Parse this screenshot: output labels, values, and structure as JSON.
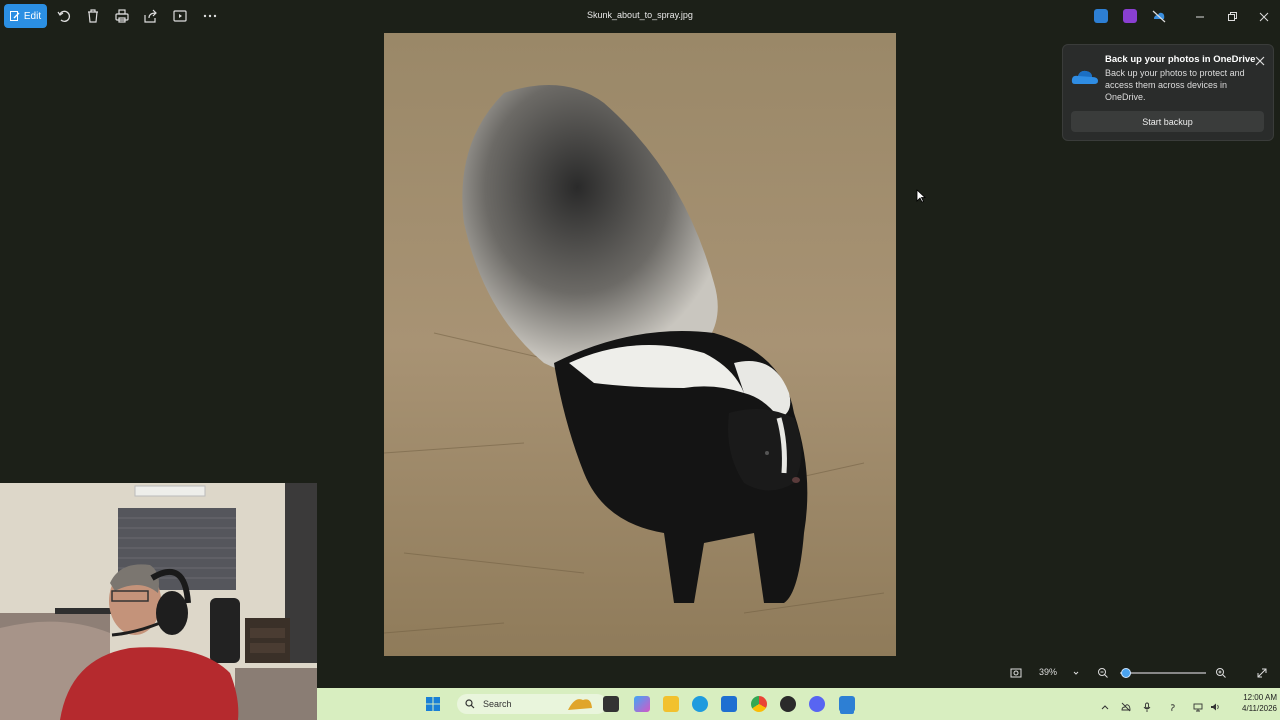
{
  "toolbar": {
    "edit_label": "Edit",
    "icons": [
      "rotate-icon",
      "delete-icon",
      "print-icon",
      "share-icon",
      "slideshow-icon",
      "more-icon"
    ]
  },
  "window": {
    "file_title": "Skunk_about_to_spray.jpg"
  },
  "notification": {
    "title": "Back up your photos in OneDrive",
    "body": "Back up your photos to protect and access them across devices in OneDrive.",
    "button": "Start backup"
  },
  "zoom": {
    "value": "39%",
    "slider_level": 0.06
  },
  "taskbar": {
    "search_placeholder": "Search",
    "time": "12:00 AM",
    "date": "4/11/2026"
  },
  "colors": {
    "accent": "#2b8fe3",
    "background": "#1c2018",
    "taskbar": "#d8eec0"
  }
}
